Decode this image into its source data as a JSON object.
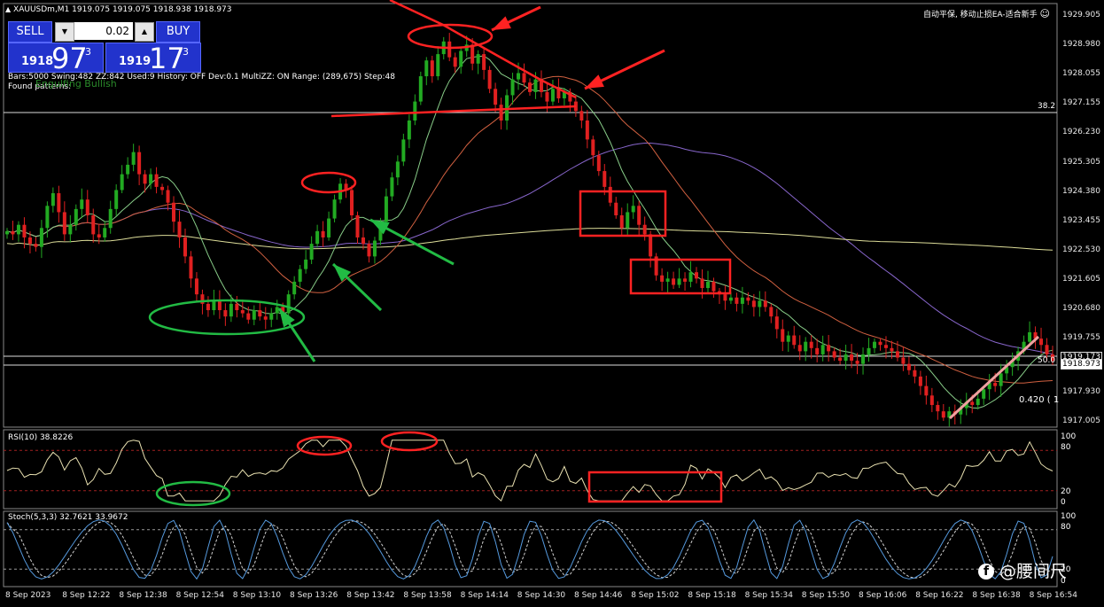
{
  "chart": {
    "title": "XAUUSDm,M1  1919.075 1919.075 1918.938 1918.973",
    "info_line": "Bars:5000  Swing:482  ZZ:842  Used:9  History: OFF Dev:0.1  MultiZZ: ON  Range: (289,675)  Step:48",
    "found_patterns": "Found patterns:",
    "engulfing": "Engulfing Bullish",
    "top_right_text": "自动平保, 移动止损EA-适合新手"
  },
  "trade_panel": {
    "sell_label": "SELL",
    "buy_label": "BUY",
    "lot_value": "0.02",
    "sell_pre": "1918",
    "sell_big": "97",
    "sell_sup": "3",
    "buy_pre": "1919",
    "buy_big": "17",
    "buy_sup": "3"
  },
  "price_axis": [
    "1929.905",
    "1928.980",
    "1928.055",
    "1927.155",
    "1926.230",
    "1925.305",
    "1924.380",
    "1923.455",
    "1922.530",
    "1921.605",
    "1920.680",
    "1919.755",
    "1917.930",
    "1917.005"
  ],
  "price_tags": {
    "current_a": "1919.173",
    "current_b": "1918.973",
    "fib_38": "38.2",
    "fib_50": "50.0",
    "fib_label": "0.420 ( 1"
  },
  "rsi": {
    "label": "RSI(10) 38.8226",
    "levels": [
      "100",
      "80",
      "20",
      "0"
    ]
  },
  "stoch": {
    "label": "Stoch(5,3,3) 32.7621 33.9672",
    "levels": [
      "100",
      "80",
      "20",
      "0"
    ]
  },
  "time_axis": [
    "8 Sep 2023",
    "8 Sep 12:22",
    "8 Sep 12:38",
    "8 Sep 12:54",
    "8 Sep 13:10",
    "8 Sep 13:26",
    "8 Sep 13:42",
    "8 Sep 13:58",
    "8 Sep 14:14",
    "8 Sep 14:30",
    "8 Sep 14:46",
    "8 Sep 15:02",
    "8 Sep 15:18",
    "8 Sep 15:34",
    "8 Sep 15:50",
    "8 Sep 16:06",
    "8 Sep 16:22",
    "8 Sep 16:38",
    "8 Sep 16:54"
  ],
  "watermark": "@腰间尺",
  "colors": {
    "bull": "#22aa22",
    "bear": "#e02020",
    "annotation_red": "#ff2222",
    "annotation_green": "#22bb44",
    "ma_fast": "#88cc88",
    "ma_mid": "#d06040",
    "ma_slow": "#8866cc",
    "ma_long": "#dddd99",
    "rsi_line": "#e8e0b0",
    "stoch_main": "#5599dd",
    "stoch_signal": "#d0d0d0",
    "trendline": "#f0a0a0"
  },
  "chart_data": {
    "type": "candlestick",
    "symbol": "XAUUSDm",
    "timeframe": "M1",
    "ylim": [
      1916.9,
      1930.3
    ],
    "closes": [
      1923.1,
      1923.0,
      1923.3,
      1922.9,
      1922.7,
      1922.6,
      1923.2,
      1923.9,
      1924.3,
      1923.7,
      1923.0,
      1923.3,
      1923.8,
      1924.1,
      1923.6,
      1923.0,
      1922.9,
      1923.2,
      1923.8,
      1924.4,
      1924.9,
      1925.2,
      1925.6,
      1924.9,
      1924.6,
      1924.9,
      1924.5,
      1924.4,
      1924.0,
      1923.4,
      1922.9,
      1922.3,
      1921.6,
      1921.1,
      1920.8,
      1920.6,
      1920.9,
      1920.6,
      1920.4,
      1920.8,
      1920.6,
      1920.5,
      1920.3,
      1920.6,
      1920.4,
      1920.3,
      1920.5,
      1920.7,
      1920.5,
      1921.1,
      1921.5,
      1921.9,
      1922.2,
      1922.7,
      1923.1,
      1922.9,
      1923.5,
      1924.1,
      1924.6,
      1924.4,
      1923.6,
      1922.9,
      1922.7,
      1922.3,
      1922.8,
      1923.4,
      1924.2,
      1924.8,
      1925.3,
      1926.0,
      1926.6,
      1927.2,
      1928.0,
      1928.5,
      1928.0,
      1928.7,
      1929.1,
      1928.6,
      1928.3,
      1928.8,
      1929.0,
      1928.4,
      1928.7,
      1928.2,
      1927.6,
      1927.1,
      1926.6,
      1927.4,
      1927.9,
      1928.1,
      1927.8,
      1927.5,
      1927.9,
      1927.5,
      1927.2,
      1927.6,
      1927.3,
      1927.5,
      1927.2,
      1926.9,
      1926.6,
      1926.0,
      1925.5,
      1925.0,
      1924.5,
      1924.0,
      1923.6,
      1923.2,
      1923.7,
      1923.9,
      1923.3,
      1923.0,
      1922.3,
      1921.7,
      1921.5,
      1921.6,
      1921.4,
      1921.6,
      1921.5,
      1921.8,
      1921.6,
      1921.3,
      1921.5,
      1921.2,
      1921.1,
      1920.9,
      1921.0,
      1920.8,
      1921.0,
      1920.9,
      1920.7,
      1920.9,
      1920.7,
      1920.4,
      1920.0,
      1919.6,
      1919.8,
      1919.5,
      1919.3,
      1919.6,
      1919.4,
      1919.2,
      1919.5,
      1919.3,
      1919.1,
      1919.0,
      1919.2,
      1919.0,
      1918.9,
      1919.2,
      1919.4,
      1919.6,
      1919.5,
      1919.4,
      1919.3,
      1919.1,
      1918.9,
      1918.7,
      1918.5,
      1918.2,
      1917.9,
      1917.6,
      1917.4,
      1917.2,
      1917.4,
      1917.3,
      1917.5,
      1917.7,
      1917.6,
      1917.8,
      1918.1,
      1918.3,
      1918.2,
      1918.6,
      1918.8,
      1919.0,
      1919.3,
      1919.6,
      1919.9,
      1919.7,
      1919.5,
      1919.2,
      1919.0
    ]
  }
}
